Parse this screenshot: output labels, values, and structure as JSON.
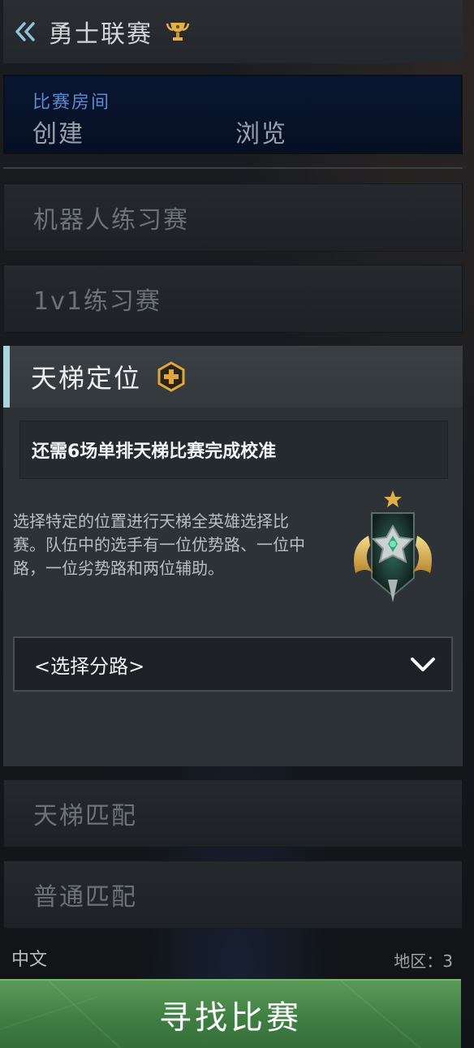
{
  "header": {
    "title": "勇士联赛",
    "back_icon": "double-chevron-left-icon",
    "trophy_icon": "trophy-icon"
  },
  "room": {
    "label": "比赛房间",
    "create": "创建",
    "browse": "浏览"
  },
  "modes": {
    "bot_practice": "机器人练习赛",
    "one_v_one": "1v1练习赛",
    "ranked_matchmaking": "天梯匹配",
    "normal_matchmaking": "普通匹配"
  },
  "ranked_roles": {
    "title": "天梯定位",
    "calibration": "还需6场单排天梯比赛完成校准",
    "description": "选择特定的位置进行天梯全英雄选择比赛。队伍中的选手有一位优势路、一位中路，一位劣势路和两位辅助。",
    "lane_select": "<选择分路>"
  },
  "footer": {
    "language": "中文",
    "region": "地区：3"
  },
  "find_match": "寻找比赛",
  "colors": {
    "accent_blue": "#5b8bd6",
    "find_green": "#3e7d42",
    "gold": "#e0a83a"
  }
}
